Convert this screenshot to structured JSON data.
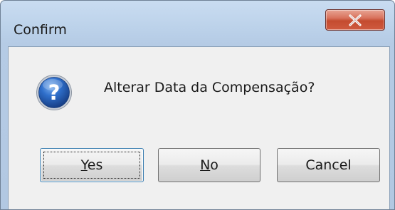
{
  "window": {
    "title": "Confirm"
  },
  "dialog": {
    "message": "Alterar Data da Compensação?",
    "icon": "question-icon"
  },
  "buttons": {
    "yes": {
      "mnemonic": "Y",
      "rest": "es"
    },
    "no": {
      "mnemonic": "N",
      "rest": "o"
    },
    "cancel": {
      "label": "Cancel"
    }
  },
  "colors": {
    "titlebar": "#bcd2ea",
    "close_button": "#c44b2f",
    "client": "#f0f0f0",
    "icon_blue": "#2a5fb0"
  }
}
